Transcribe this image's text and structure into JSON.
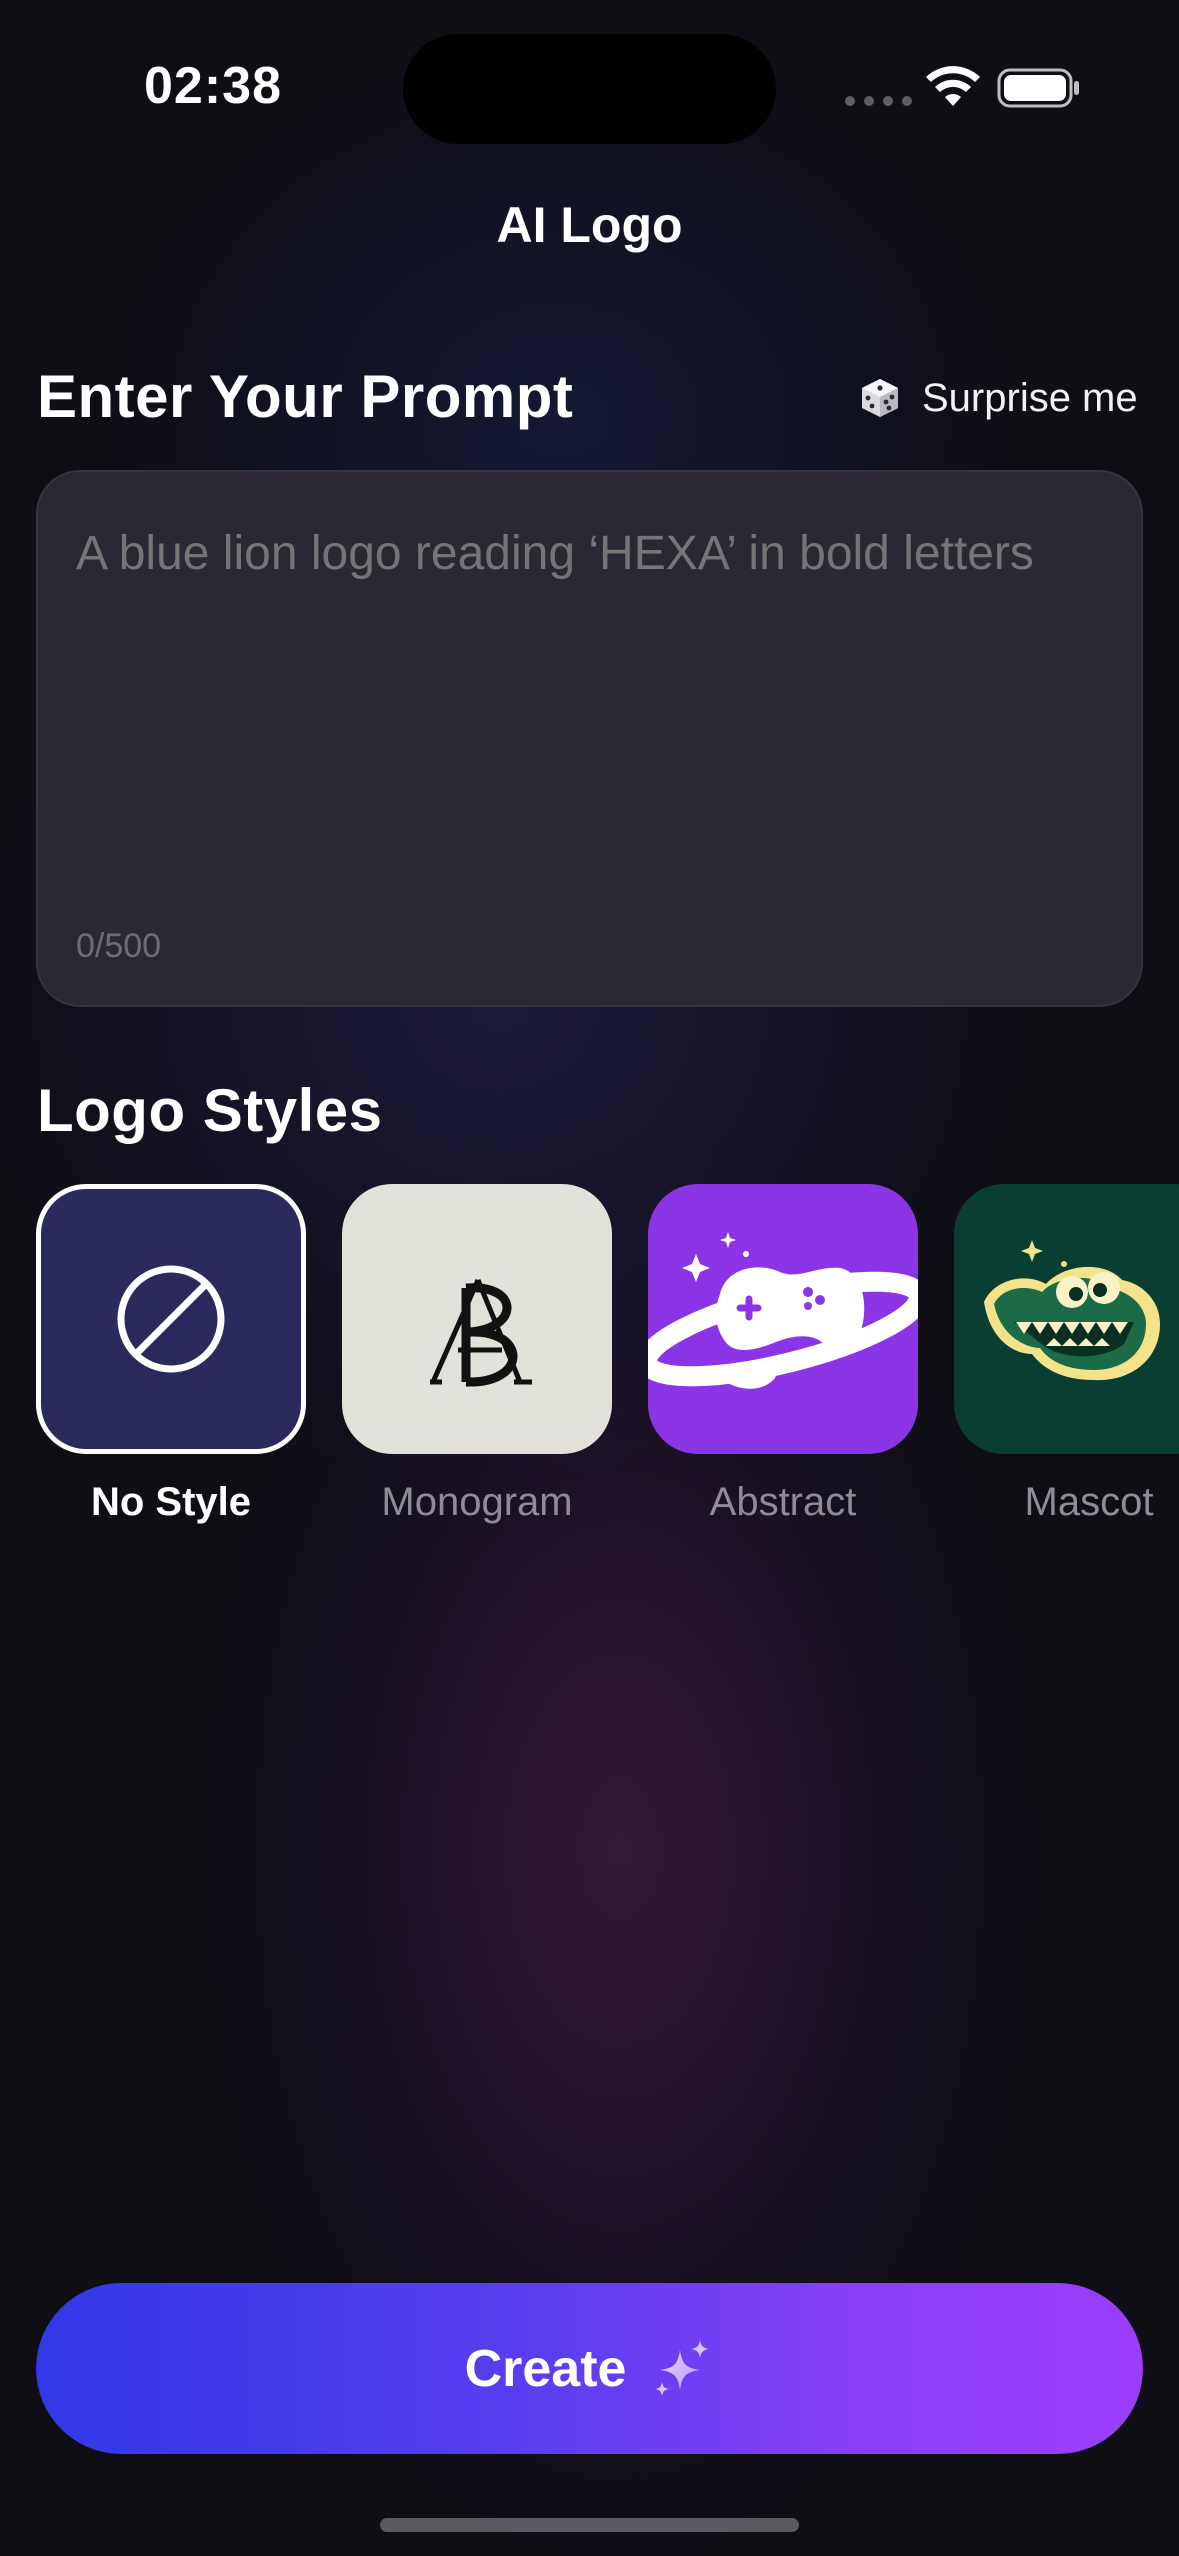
{
  "status_bar": {
    "time": "02:38"
  },
  "header": {
    "title": "AI Logo"
  },
  "prompt": {
    "section_title": "Enter Your Prompt",
    "surprise_label": "Surprise me",
    "placeholder": "A blue lion logo reading ‘HEXA’ in bold letters",
    "value": "",
    "counter": "0/500"
  },
  "styles": {
    "section_title": "Logo Styles",
    "selected": "No Style",
    "items": [
      {
        "label": "No Style",
        "icon": "no-style-icon"
      },
      {
        "label": "Monogram",
        "icon": "monogram-icon"
      },
      {
        "label": "Abstract",
        "icon": "planet-gamepad-icon"
      },
      {
        "label": "Mascot",
        "icon": "crocodile-mascot-icon"
      }
    ]
  },
  "create_button": {
    "label": "Create",
    "icon": "sparkle-icon"
  },
  "colors": {
    "background": "#0f0e15",
    "prompt_box": "#2b2834",
    "accent_start": "#3138e6",
    "accent_end": "#9b3efc"
  }
}
